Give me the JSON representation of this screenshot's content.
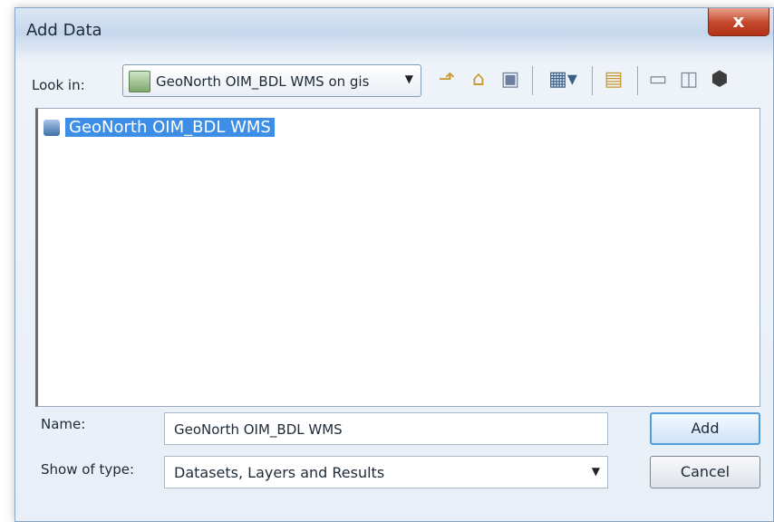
{
  "window": {
    "title": "Add Data",
    "close_label": "x"
  },
  "lookin": {
    "label": "Look in:",
    "value": "GeoNorth OIM_BDL WMS on gis"
  },
  "toolbar_icons": [
    "up-one-level-icon",
    "home-icon",
    "connect-folder-icon",
    "view-menu-icon",
    "new-folder-icon",
    "catalog-icon",
    "toolbox-icon",
    "database-icon"
  ],
  "list": {
    "items": [
      {
        "label": "GeoNorth OIM_BDL WMS",
        "icon": "wms-layer-icon",
        "selected": true
      }
    ]
  },
  "name": {
    "label": "Name:",
    "value": "GeoNorth OIM_BDL WMS"
  },
  "type": {
    "label": "Show of type:",
    "value": "Datasets, Layers and Results"
  },
  "buttons": {
    "add": "Add",
    "cancel": "Cancel"
  },
  "colors": {
    "accent": "#3d8ee6",
    "close": "#c2462a"
  }
}
